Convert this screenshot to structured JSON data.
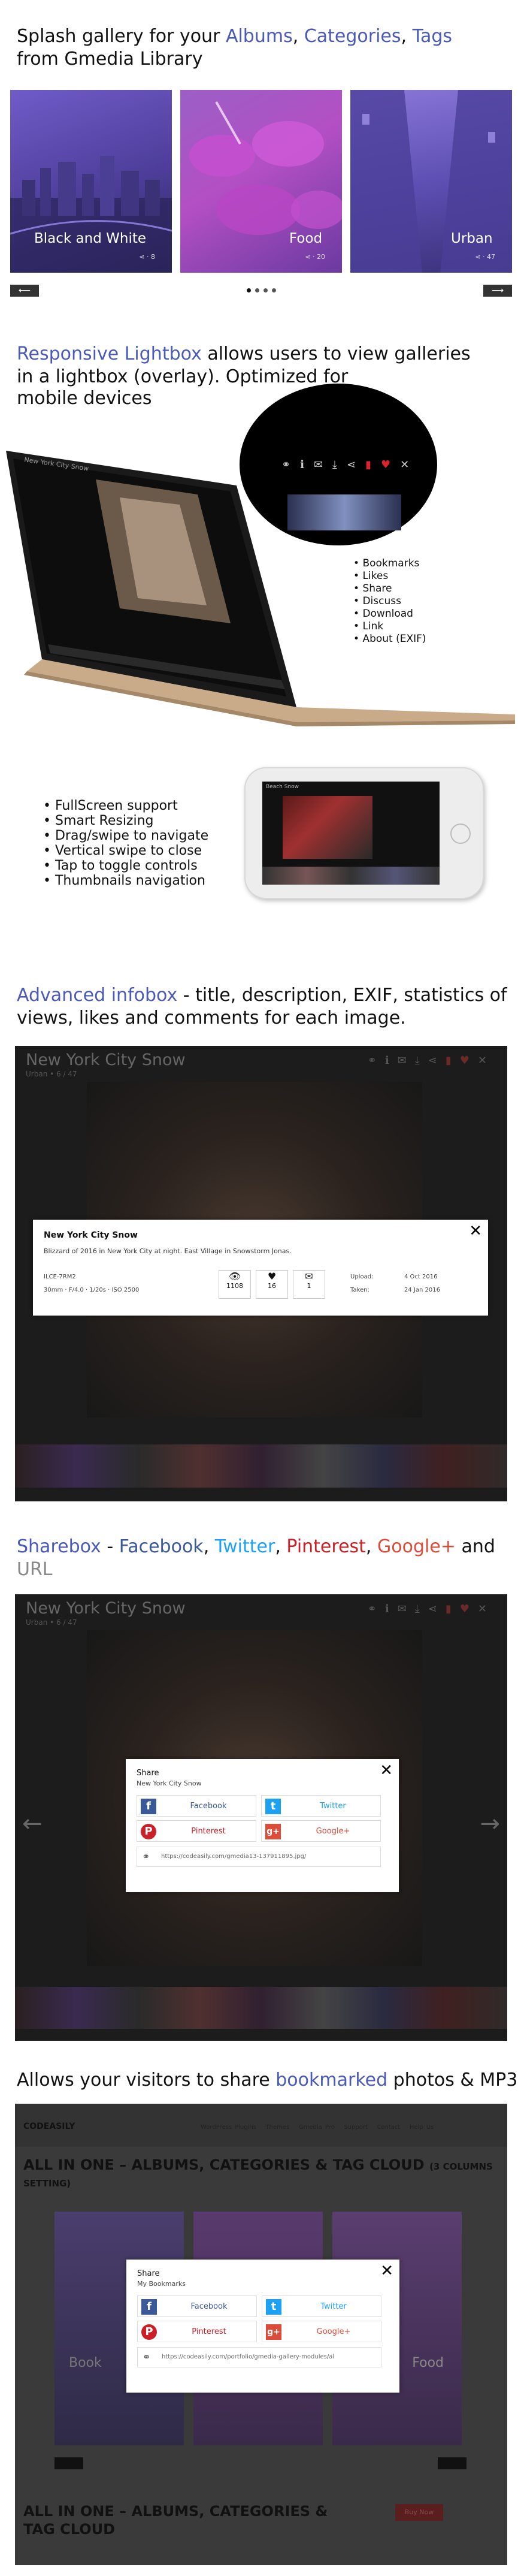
{
  "s1": {
    "t1": "Splash gallery for your ",
    "albums": "Albums",
    "comma1": ", ",
    "categories": "Categories",
    "comma2": ", ",
    "tags": "Tags",
    "line2": "from Gmedia Library",
    "tiles": [
      {
        "label": "Black and White",
        "count": "8"
      },
      {
        "label": "Food",
        "count": "20"
      },
      {
        "label": "Urban",
        "count": "47"
      }
    ]
  },
  "s2": {
    "title": "Responsive Lightbox",
    "rest": " allows users to view galleries",
    "line2": "in a lightbox (overlay). Optimized for",
    "line3": "mobile devices",
    "laptop_title": "New York City Snow",
    "bullets": [
      "Bookmarks",
      "Likes",
      "Share",
      "Discuss",
      "Download",
      "Link",
      "About (EXIF)"
    ]
  },
  "s3": {
    "bullets": [
      "FullScreen support",
      "Smart Resizing",
      "Drag/swipe to navigate",
      "Vertical swipe to close",
      "Tap to toggle controls",
      "Thumbnails navigation"
    ],
    "phone_title": "Beach Snow"
  },
  "s4": {
    "title": "Advanced infobox",
    "rest": " - title, description, EXIF, statistics of",
    "line2": "views, likes and comments for each image.",
    "panel_title": "New York City Snow",
    "panel_sub": "Urban • 6 / 47",
    "info_title": "New York City Snow",
    "info_desc": "Blizzard of 2016 in New York City at night. East Village in Snowstorm Jonas.",
    "camera": "ILCE-7RM2",
    "exif": "30mm  ·  F/4.0  ·  1/20s  ·  ISO 2500",
    "views": "1108",
    "likes": "16",
    "comments": "1",
    "upload_label": "Upload:",
    "upload_val": "4 Oct 2016",
    "taken_label": "Taken:",
    "taken_val": "24 Jan 2016"
  },
  "s5": {
    "title": "Sharebox",
    "dash": " - ",
    "fb": "Facebook",
    "c1": ", ",
    "tw": "Twitter",
    "c2": ", ",
    "pin": "Pinterest",
    "c3": ", ",
    "gp": "Google+",
    "and": " and",
    "url": "URL",
    "panel_title": "New York City Snow",
    "panel_sub": "Urban • 6 / 47",
    "share_title": "Share",
    "share_sub": "New York City Snow",
    "btn_fb": "Facebook",
    "btn_tw": "Twitter",
    "btn_pin": "Pinterest",
    "btn_gp": "Google+",
    "link": "https://codeasily.com/gmedia13-137911895.jpg/"
  },
  "s6": {
    "t1": "Allows your visitors to share ",
    "bm": "bookmarked",
    "t2": " photos & MP3",
    "site_logo": "CODEASILY",
    "nav": [
      "WordPress Plugins",
      "Themes",
      "Gmedia Pro",
      "Support",
      "Contact",
      "Help Us"
    ],
    "heading": "ALL IN ONE – ALBUMS, CATEGORIES & TAG CLOUD",
    "heading_small": "(3 COLUMNS SETTING)",
    "share_title": "Share",
    "share_sub": "My Bookmarks",
    "btn_fb": "Facebook",
    "btn_tw": "Twitter",
    "btn_pin": "Pinterest",
    "btn_gp": "Google+",
    "link": "https://codeasily.com/portfolio/gmedia-gallery-modules/al",
    "tile_left": "Book",
    "tile_right": "Food",
    "heading2a": "ALL IN ONE – ALBUMS, CATEGORIES &",
    "heading2b": "TAG CLOUD",
    "buy": "Buy Now"
  },
  "colors": {
    "accent": "#4a5ab8",
    "facebook": "#3b5998",
    "twitter": "#1da1f2",
    "pinterest": "#cb2027",
    "googleplus": "#dd4b39"
  }
}
